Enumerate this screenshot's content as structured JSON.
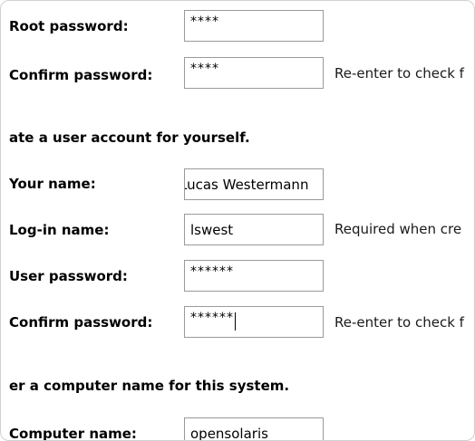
{
  "root_password": {
    "label": "Root password:",
    "value": "****"
  },
  "root_confirm": {
    "label": "Confirm password:",
    "value": "****",
    "hint": "Re-enter to check f"
  },
  "user_section": {
    "heading": "ate a user account for yourself."
  },
  "your_name": {
    "label": "Your name:",
    "value": "Lucas Westermann"
  },
  "login_name": {
    "label": "Log-in name:",
    "value": "lswest",
    "hint": "Required when cre"
  },
  "user_password": {
    "label": "User password:",
    "value": "******"
  },
  "user_confirm": {
    "label": "Confirm password:",
    "value": "******",
    "hint": "Re-enter to check f"
  },
  "computer_section": {
    "heading": "er a computer name for this system."
  },
  "computer_name": {
    "label": "Computer name:",
    "value": "opensolaris"
  }
}
